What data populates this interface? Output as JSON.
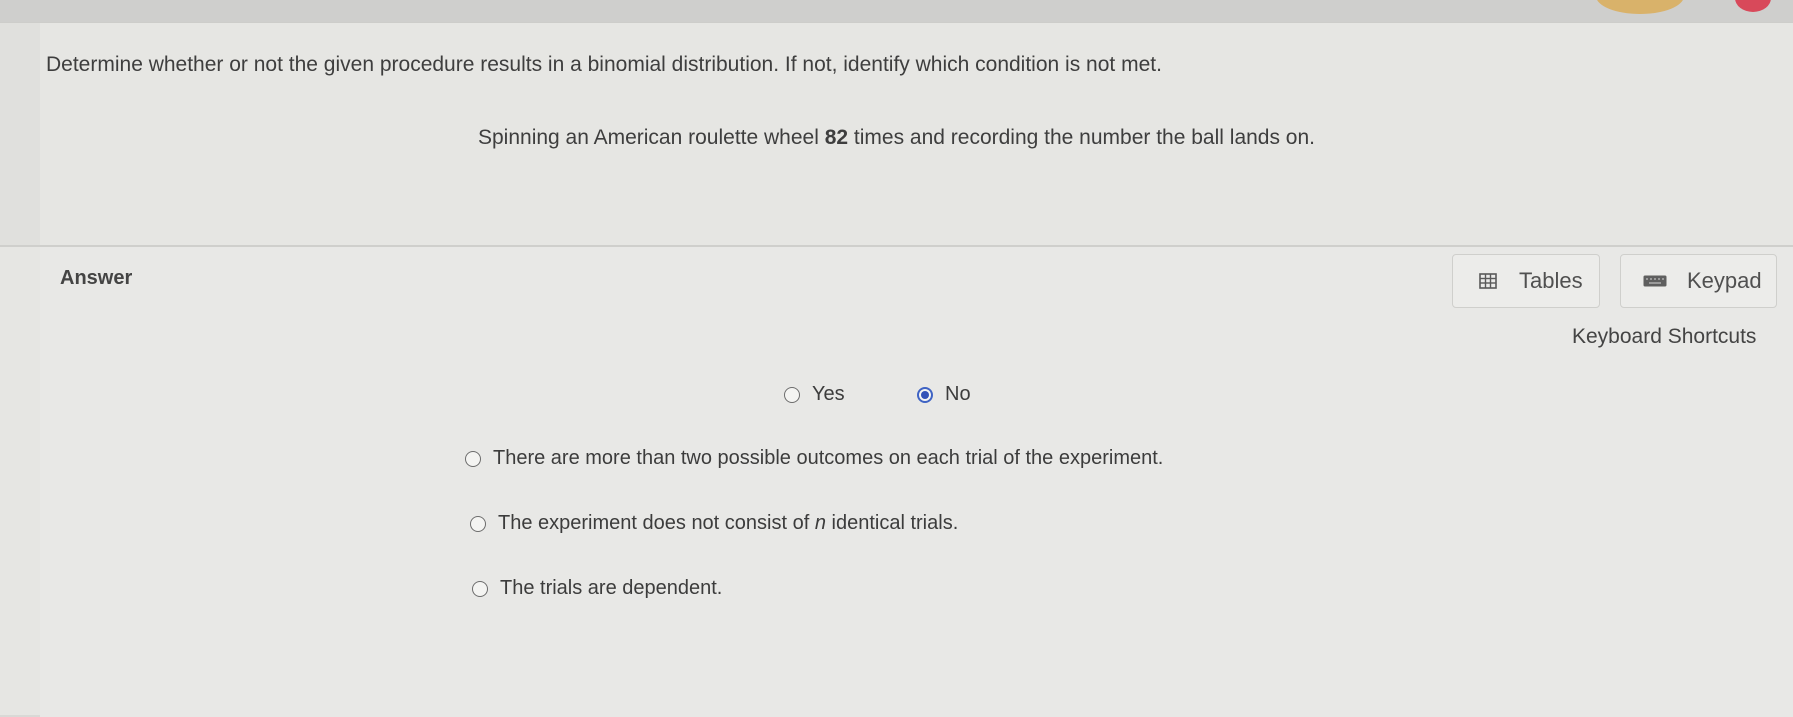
{
  "question": {
    "prompt": "Determine whether or not the given procedure results in a binomial distribution. If not, identify which condition is not met.",
    "scenario_before": "Spinning an American roulette wheel ",
    "scenario_number": "82",
    "scenario_after": " times and recording the number the ball lands on."
  },
  "answer": {
    "label": "Answer",
    "tools": {
      "tables_label": "Tables",
      "tables_icon": "table-icon",
      "keypad_label": "Keypad",
      "keypad_icon": "keyboard-icon",
      "shortcuts_label": "Keyboard Shortcuts"
    },
    "binomial_choice": {
      "yes_label": "Yes",
      "no_label": "No",
      "selected": "No"
    },
    "conditions": {
      "option_a": "There are more than two possible outcomes on each trial of the experiment.",
      "option_b_before": "The experiment does not consist of ",
      "option_b_var": "n",
      "option_b_after": " identical trials.",
      "option_c": "The trials are dependent."
    }
  },
  "colors": {
    "accent": "#3352b8",
    "panel_bg": "#e6e6e3"
  }
}
